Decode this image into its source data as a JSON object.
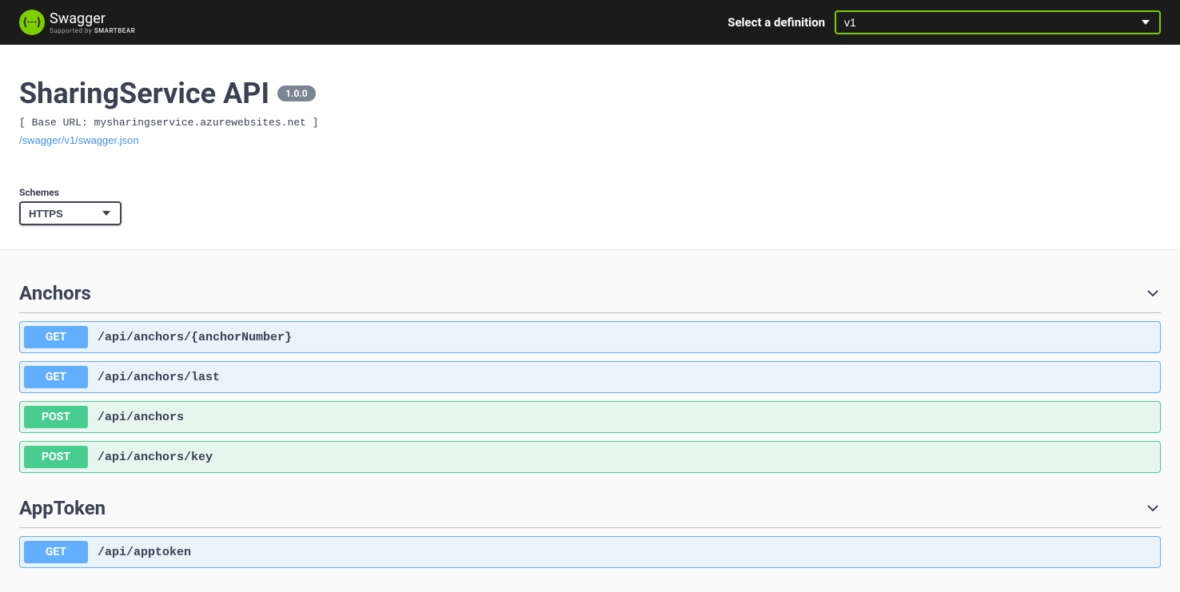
{
  "topbar": {
    "brand_name": "Swagger",
    "brand_mark": "{···}",
    "supported_by_prefix": "Supported by ",
    "supported_by_brand": "SMARTBEAR",
    "def_label": "Select a definition",
    "def_selected": "v1"
  },
  "info": {
    "title": "SharingService API",
    "version": "1.0.0",
    "base_url": "[ Base URL: mysharingservice.azurewebsites.net ]",
    "swagger_json_link": "/swagger/v1/swagger.json"
  },
  "schemes": {
    "label": "Schemes",
    "selected": "HTTPS"
  },
  "tags": [
    {
      "name": "Anchors",
      "ops": [
        {
          "method": "GET",
          "path": "/api/anchors/{anchorNumber}"
        },
        {
          "method": "GET",
          "path": "/api/anchors/last"
        },
        {
          "method": "POST",
          "path": "/api/anchors"
        },
        {
          "method": "POST",
          "path": "/api/anchors/key"
        }
      ]
    },
    {
      "name": "AppToken",
      "ops": [
        {
          "method": "GET",
          "path": "/api/apptoken"
        }
      ]
    }
  ]
}
